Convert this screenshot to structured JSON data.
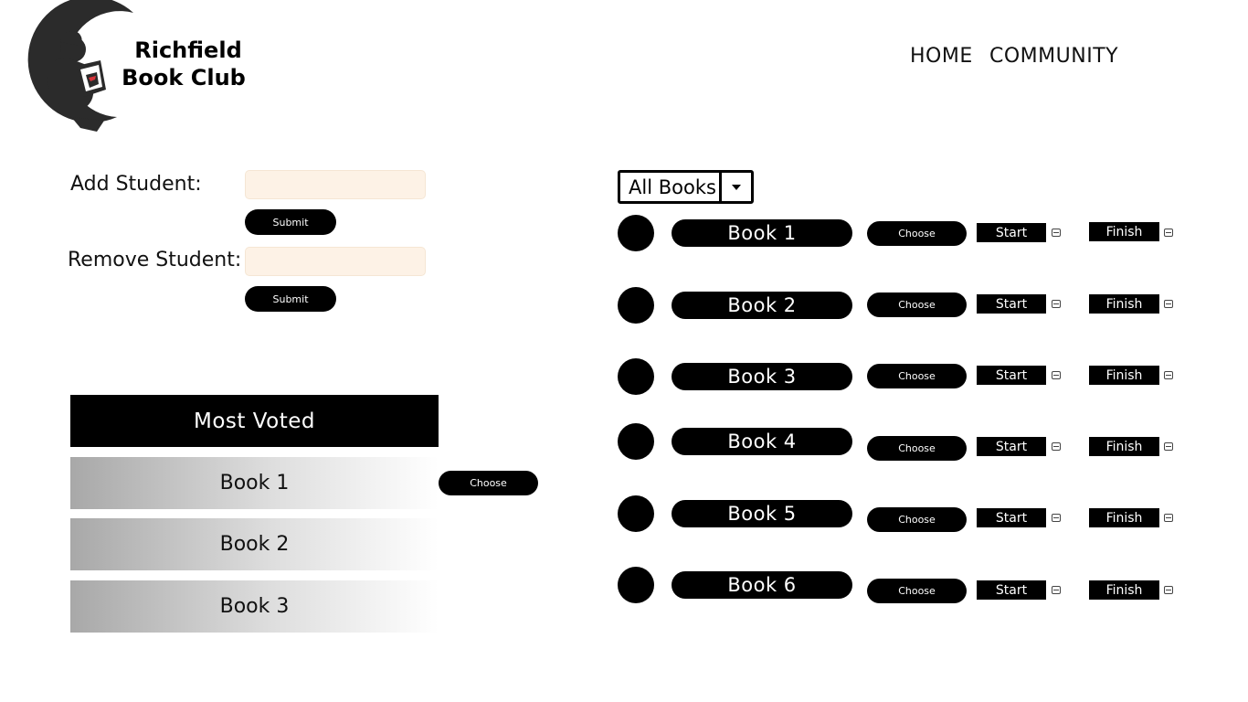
{
  "logo": {
    "line1": "Richfield",
    "line2": "Book Club"
  },
  "nav": {
    "home": "HOME",
    "community": "COMMUNITY"
  },
  "students": {
    "add_label": "Add Student:",
    "add_value": "",
    "remove_label": "Remove Student:",
    "remove_value": "",
    "submit_label": "Submit"
  },
  "most_voted": {
    "title": "Most Voted",
    "items": [
      "Book 1",
      "Book 2",
      "Book 3"
    ],
    "choose_label": "Choose"
  },
  "filter": {
    "selected": "All Books"
  },
  "books": {
    "items": [
      "Book 1",
      "Book 2",
      "Book 3",
      "Book 4",
      "Book 5",
      "Book 6"
    ],
    "choose_label": "Choose",
    "start_label": "Start",
    "finish_label": "Finish"
  },
  "colors": {
    "input_bg": "#fdf2e6",
    "accent": "#000000",
    "logo_red": "#d8343a"
  }
}
